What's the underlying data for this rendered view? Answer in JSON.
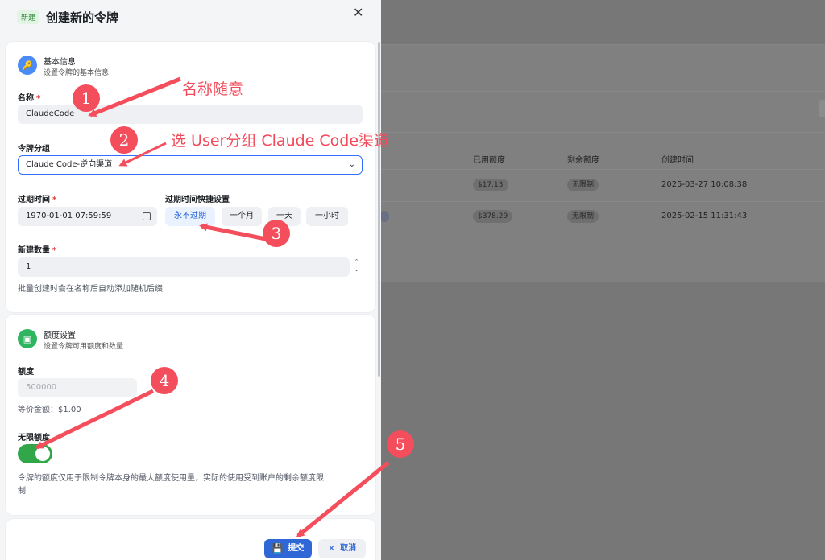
{
  "background": {
    "columns": [
      "已用额度",
      "剩余额度",
      "创建时间"
    ],
    "rows": [
      {
        "used": "$17.13",
        "remaining": "无限制",
        "created": "2025-03-27 10:08:38"
      },
      {
        "used": "$378.29",
        "remaining": "无限制",
        "created": "2025-02-15 11:31:43"
      }
    ]
  },
  "header": {
    "tag": "新建",
    "title": "创建新的令牌",
    "close": "✕"
  },
  "basic": {
    "title": "基本信息",
    "subtitle": "设置令牌的基本信息",
    "name_label": "名称",
    "name_value": "ClaudeCode",
    "group_label": "令牌分组",
    "group_value": "Claude Code-逆向渠道",
    "expire_label": "过期时间",
    "expire_value": "1970-01-01 07:59:59",
    "quick_label": "过期时间快捷设置",
    "quick_options": [
      "永不过期",
      "一个月",
      "一天",
      "一小时"
    ],
    "count_label": "新建数量",
    "count_value": "1",
    "count_hint": "批量创建时会在名称后自动添加随机后缀",
    "required_mark": "*"
  },
  "quota": {
    "title": "额度设置",
    "subtitle": "设置令牌可用额度和数量",
    "amount_label": "额度",
    "amount_placeholder": "500000",
    "equiv": "等价金额：$1.00",
    "unlimited_label": "无限额度",
    "unlimited_on": true,
    "note_line1": "令牌的额度仅用于限制令牌本身的最大额度使用量，实际的使用受到账户的剩余额度限",
    "note_line2": "制"
  },
  "footer": {
    "submit": "提交",
    "cancel": "取消"
  },
  "annotations": {
    "n1": "1",
    "n2": "2",
    "n3": "3",
    "n4": "4",
    "n5": "5",
    "text1": "名称随意",
    "text2": "选 User分组 Claude Code渠道",
    "color": "#f44e5c"
  }
}
